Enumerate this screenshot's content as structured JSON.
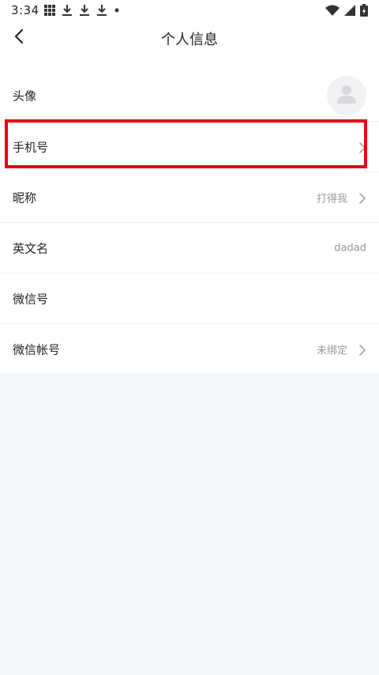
{
  "status_bar": {
    "time": "3:34",
    "icons": [
      "grid-icon",
      "download-icon",
      "download-icon",
      "download-icon",
      "dot-icon",
      "wifi-icon",
      "signal-icon",
      "battery-icon"
    ]
  },
  "nav": {
    "back_icon": "chevron-left-icon",
    "title": "个人信息"
  },
  "profile_rows": [
    {
      "label": "头像",
      "value": "",
      "has_chevron": false,
      "has_avatar": true
    },
    {
      "label": "手机号",
      "value": "",
      "has_chevron": true,
      "highlighted": true
    },
    {
      "label": "昵称",
      "value": "打得我",
      "has_chevron": true
    },
    {
      "label": "英文名",
      "value": "dadad",
      "has_chevron": false
    },
    {
      "label": "微信号",
      "value": "",
      "has_chevron": false
    },
    {
      "label": "微信帐号",
      "value": "未绑定",
      "has_chevron": true
    }
  ],
  "colors": {
    "highlight": "#e60012",
    "page_background": "#f5f6fa",
    "secondary_text": "#999999"
  }
}
